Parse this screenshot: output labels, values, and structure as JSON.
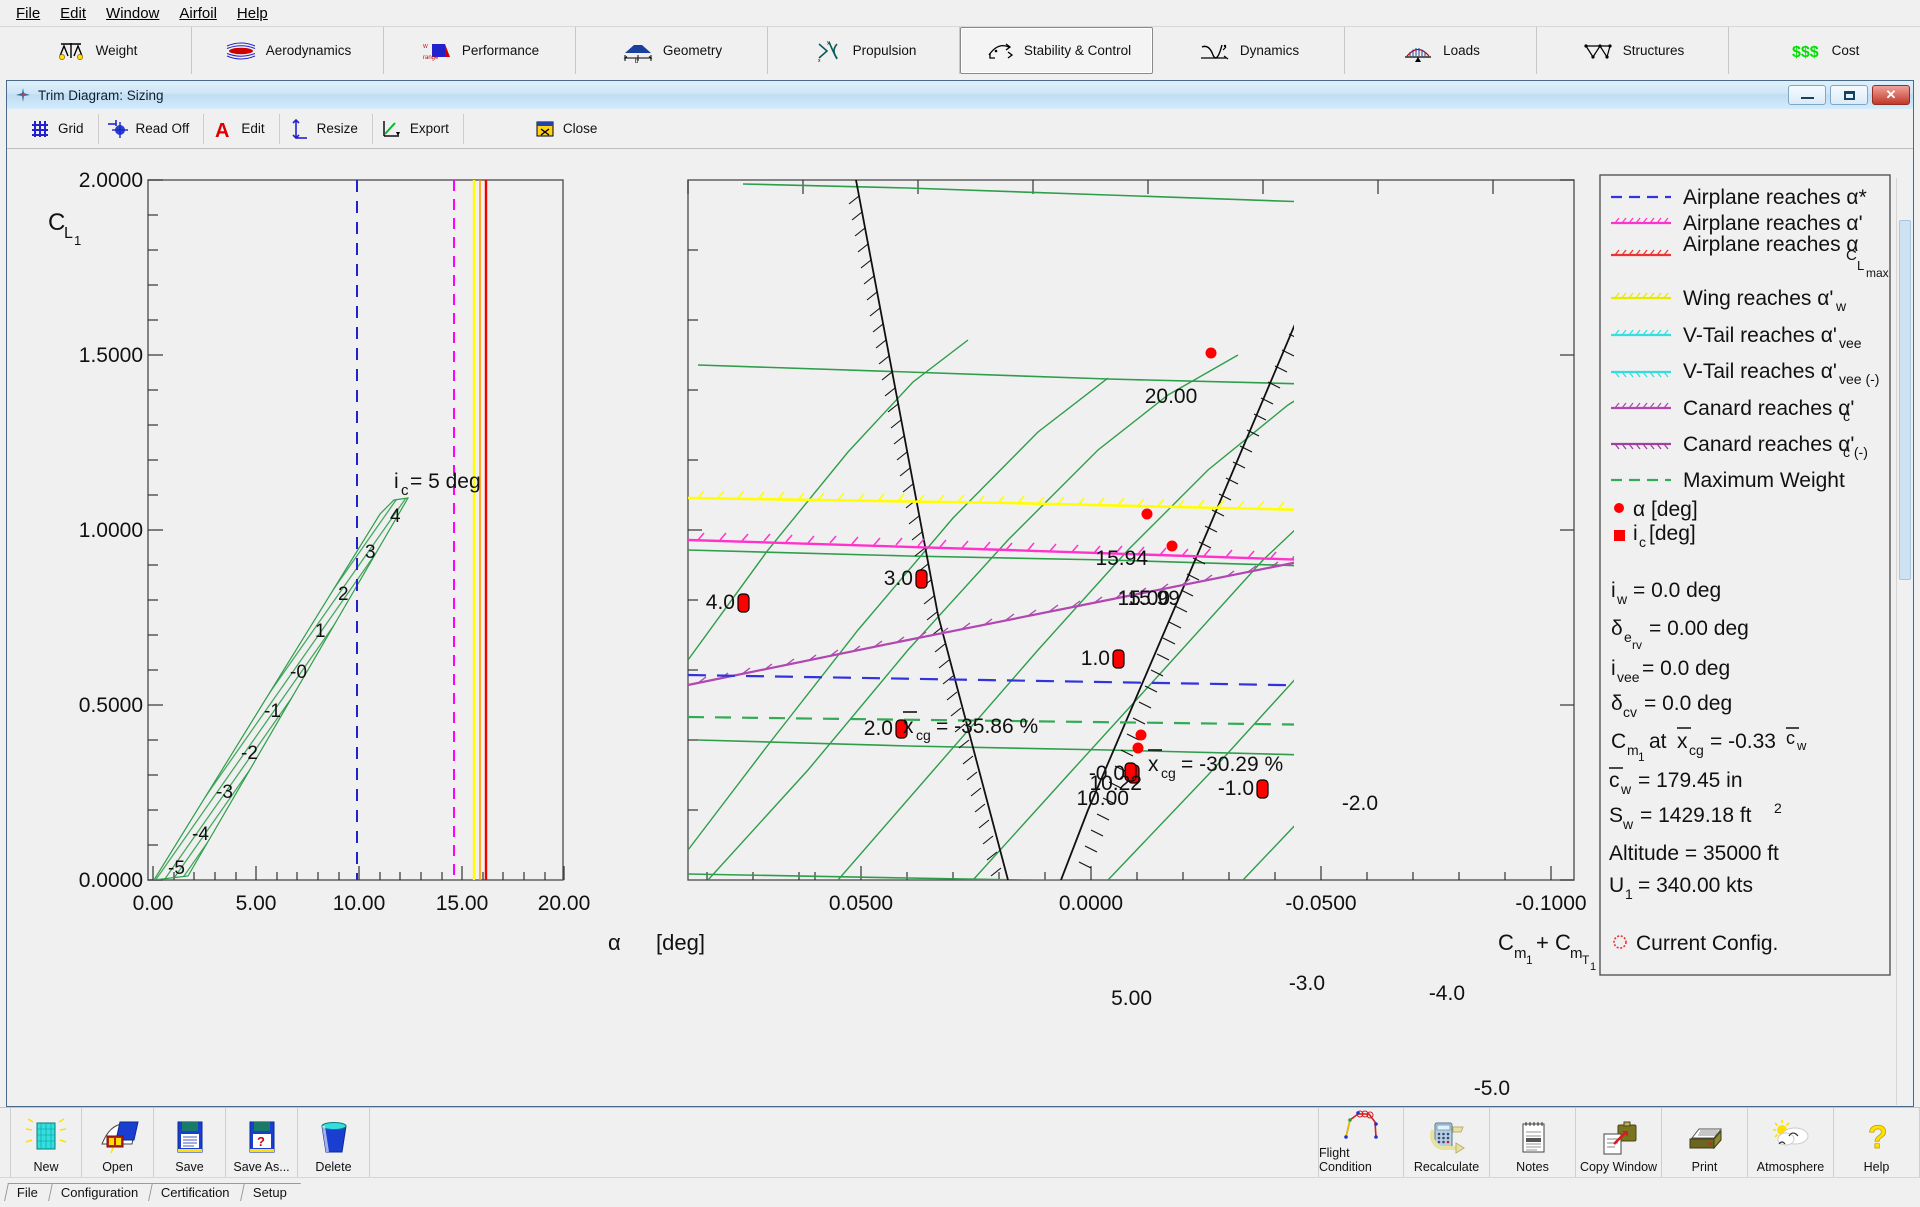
{
  "menubar": {
    "items": [
      {
        "label": "File",
        "accel": "F"
      },
      {
        "label": "Edit",
        "accel": "E"
      },
      {
        "label": "Window",
        "accel": "W"
      },
      {
        "label": "Airfoil",
        "accel": "A"
      },
      {
        "label": "Help",
        "accel": "H"
      }
    ]
  },
  "modules": [
    {
      "label": "Weight",
      "icon": "balance-scale-icon",
      "active": false
    },
    {
      "label": "Aerodynamics",
      "icon": "airfoil-flow-icon",
      "active": false
    },
    {
      "label": "Performance",
      "icon": "range-chart-icon",
      "active": false
    },
    {
      "label": "Geometry",
      "icon": "wing-span-icon",
      "active": false
    },
    {
      "label": "Propulsion",
      "icon": "propeller-icon",
      "active": false
    },
    {
      "label": "Stability & Control",
      "icon": "aircraft-axes-icon",
      "active": true
    },
    {
      "label": "Dynamics",
      "icon": "response-curve-icon",
      "active": false
    },
    {
      "label": "Loads",
      "icon": "load-distribution-icon",
      "active": false
    },
    {
      "label": "Structures",
      "icon": "truss-icon",
      "active": false
    },
    {
      "label": "Cost",
      "icon": "dollar-icon",
      "active": false
    }
  ],
  "window": {
    "title": "Trim Diagram: Sizing",
    "icon": "aircraft-window-icon",
    "buttons": {
      "minimize": "Minimize",
      "maximize": "Maximize",
      "close": "Close"
    }
  },
  "toolbar": [
    {
      "label": "Grid",
      "icon": "grid-icon"
    },
    {
      "label": "Read Off",
      "icon": "crosshair-icon"
    },
    {
      "label": "Edit",
      "icon": "letter-a-icon"
    },
    {
      "label": "Resize",
      "icon": "resize-arrows-icon"
    },
    {
      "label": "Export",
      "icon": "export-chart-icon"
    },
    {
      "label": "Close",
      "icon": "close-window-icon"
    }
  ],
  "chart_data": {
    "type": "line",
    "title": "Trim Diagram: Sizing",
    "ylabel": "C_L1",
    "ylim": [
      0.0,
      2.0
    ],
    "yticks": [
      "0.0000",
      "0.5000",
      "1.0000",
      "1.5000",
      "2.0000"
    ],
    "left_panel": {
      "xlabel": "α   [deg]",
      "xlim": [
        0.0,
        20.0
      ],
      "xticks": [
        "0.00",
        "5.00",
        "10.00",
        "15.00",
        "20.00"
      ],
      "annotation": "i_c = 5 deg",
      "carpet_labels": [
        "4",
        "3",
        "2",
        "1",
        "-0",
        "-1",
        "-2",
        "-3",
        "-4",
        "-5"
      ],
      "vertical_lines": [
        {
          "alpha": 9.9,
          "color": "#2222cc",
          "style": "dashed",
          "name": "Airplane reaches alpha*"
        },
        {
          "alpha": 14.6,
          "color": "#ff00ff",
          "style": "solid",
          "name": "Airplane reaches alpha-prime"
        },
        {
          "alpha": 15.55,
          "color": "#ffff00",
          "style": "solid",
          "name": "Wing reaches alpha-prime-w"
        },
        {
          "alpha": 15.8,
          "color": "#ff0000",
          "style": "solid",
          "name": "Airplane reaches alpha-CLmax"
        }
      ]
    },
    "right_panel": {
      "xlabel": "C_m1 + C_mT1",
      "xlim": [
        0.0667,
        -0.1
      ],
      "xticks": [
        "0.0500",
        "0.0000",
        "-0.0500",
        "-0.1000"
      ],
      "ic_labels": [
        "4.0",
        "3.0",
        "2.0",
        "1.0",
        "-0.0",
        "-1.0",
        "-2.0",
        "-3.0",
        "-4.0",
        "-5.0"
      ],
      "alpha_labels": [
        "20.00",
        "15.94",
        "15.00",
        "15.99",
        "10.00",
        "10.22",
        "5.00"
      ],
      "cg_annotations": [
        {
          "text": "x̄cg = -35.86 %"
        },
        {
          "text": "x̄cg = -30.29 %"
        }
      ]
    }
  },
  "legend": {
    "entries": [
      {
        "label": "Airplane reaches α*",
        "color": "#3333dd",
        "style": "dashed",
        "sub": ""
      },
      {
        "label": "Airplane reaches α'",
        "color": "#ff33cc",
        "style": "hatched",
        "sub": ""
      },
      {
        "label": "Airplane reaches α",
        "color": "#ee3333",
        "style": "hatched",
        "sub": "CLmax"
      },
      {
        "label": "Wing reaches α'",
        "color": "#ffff33",
        "style": "hatched",
        "sub": "w"
      },
      {
        "label": "V-Tail reaches α'",
        "color": "#33e0e0",
        "style": "hatched",
        "sub": "vee"
      },
      {
        "label": "V-Tail reaches α'",
        "color": "#33dddd",
        "style": "hatched-down",
        "sub": "vee (-)"
      },
      {
        "label": "Canard reaches α'",
        "color": "#b048b0",
        "style": "hatched",
        "sub": "c"
      },
      {
        "label": "Canard reaches α'",
        "color": "#a040a0",
        "style": "hatched-down",
        "sub": "c (-)"
      },
      {
        "label": "Maximum Weight",
        "color": "#33aa55",
        "style": "dashed",
        "sub": ""
      }
    ],
    "markers": [
      {
        "label": "α [deg]",
        "shape": "circle",
        "color": "#ff0000"
      },
      {
        "label": "i_c [deg]",
        "shape": "square",
        "color": "#ff0000"
      }
    ],
    "params": [
      "i_w = 0.0 deg",
      "δ_erv = 0.00 deg",
      "i_vee = 0.0 deg",
      "δ_cv = 0.0 deg",
      "C_m1 at x̄cg = -0.33 c̄w",
      "c̄w = 179.45 in",
      "S_w = 1429.18 ft2",
      "Altitude = 35000 ft",
      "U_1 = 340.00 kts"
    ],
    "params_rich": [
      {
        "base": "i",
        "sub": "w",
        "rest": " = 0.0 deg"
      },
      {
        "base": "δ",
        "sub": "e",
        "sub2": "rv",
        "rest": " = 0.00 deg"
      },
      {
        "base": "i",
        "sub": "vee",
        "rest": " = 0.0 deg"
      },
      {
        "base": "δ",
        "sub": "cv",
        "rest": " = 0.0 deg"
      },
      {
        "base": "C",
        "sub": "m1",
        "rest": " at x̄cg = -0.33 c̄w"
      },
      {
        "base": "c̄",
        "sub": "w",
        "rest": " = 179.45 in"
      },
      {
        "base": "S",
        "sub": "w",
        "rest": " = 1429.18 ft",
        "sup": "2"
      },
      {
        "base": "Altitude = 35000 ft",
        "sub": "",
        "rest": ""
      },
      {
        "base": "U",
        "sub": "1",
        "rest": " = 340.00 kts"
      }
    ],
    "current_config": "Current Config."
  },
  "bottombar": {
    "left": [
      {
        "label": "New",
        "icon": "new-document-icon"
      },
      {
        "label": "Open",
        "icon": "open-folder-icon"
      },
      {
        "label": "Save",
        "icon": "floppy-save-icon"
      },
      {
        "label": "Save As...",
        "icon": "floppy-saveas-icon"
      },
      {
        "label": "Delete",
        "icon": "trash-bin-icon"
      }
    ],
    "right": [
      {
        "label": "Flight Condition",
        "icon": "flight-envelope-icon"
      },
      {
        "label": "Recalculate",
        "icon": "calculator-icon"
      },
      {
        "label": "Notes",
        "icon": "notepad-icon"
      },
      {
        "label": "Copy Window",
        "icon": "copy-window-icon"
      },
      {
        "label": "Print",
        "icon": "printer-icon"
      },
      {
        "label": "Atmosphere",
        "icon": "sun-cloud-icon"
      },
      {
        "label": "Help",
        "icon": "question-mark-icon"
      }
    ]
  },
  "tabs": [
    {
      "label": "File"
    },
    {
      "label": "Configuration"
    },
    {
      "label": "Certification"
    },
    {
      "label": "Setup"
    }
  ],
  "colors": {
    "accent_blue": "#3333dd",
    "magenta": "#ff33cc",
    "red": "#ee3333",
    "yellow": "#ffff33",
    "cyan": "#33e0e0",
    "purple": "#b048b0",
    "green": "#33aa55",
    "marker_red": "#ff0000"
  }
}
